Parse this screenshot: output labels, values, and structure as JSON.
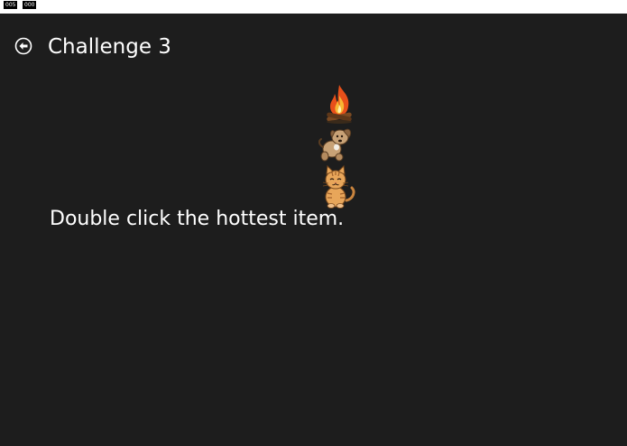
{
  "counters": {
    "left": "005",
    "right": "000"
  },
  "header": {
    "back_icon": "circle-arrow-left-icon",
    "title": "Challenge 3"
  },
  "items": [
    {
      "name": "fire",
      "icon": "campfire-icon"
    },
    {
      "name": "dog",
      "icon": "dog-icon"
    },
    {
      "name": "cat",
      "icon": "cat-icon"
    }
  ],
  "instruction": "Double click the hottest item.",
  "colors": {
    "background": "#1d1d1d",
    "text": "#ffffff",
    "flame_outer": "#e8501a",
    "flame_inner": "#f7b733",
    "wood": "#7a4a22",
    "dog_fur": "#c8a276",
    "cat_fur": "#e8a65a"
  }
}
